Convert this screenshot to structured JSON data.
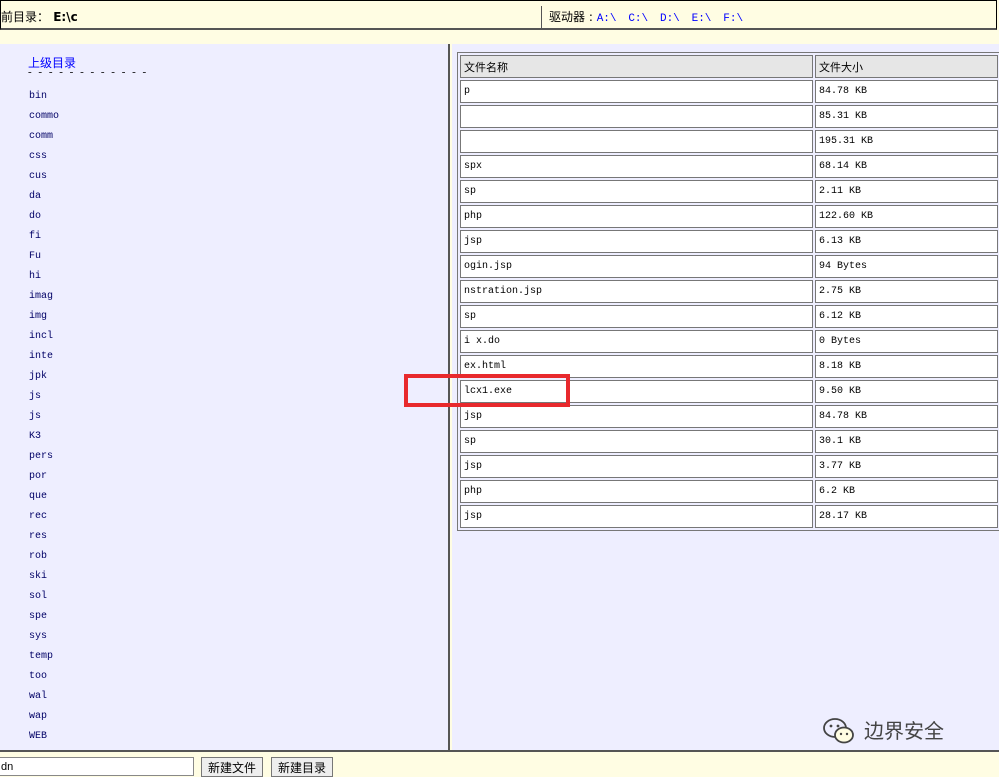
{
  "header": {
    "current_dir_label": "前目录：",
    "current_dir_value": "E:\\c",
    "drives_label": "驱动器 :",
    "drives": [
      "A:\\",
      "C:\\",
      "D:\\",
      "E:\\",
      "F:\\"
    ]
  },
  "sidebar": {
    "parent_link": "上级目录",
    "dashes": "- - - - - - - - - - - -",
    "dirs": [
      "bin",
      "commo",
      "comm",
      "css",
      "cus",
      "da",
      "do",
      "fi",
      "Fu",
      "hi",
      "imag",
      "img",
      "incl",
      "inte",
      "jpk",
      "js",
      "js",
      "K3",
      "pers",
      "por",
      "que",
      "rec",
      "res",
      "rob",
      "ski",
      "sol",
      "spe",
      "sys",
      "temp",
      "too",
      "wal",
      "wap",
      "WEB"
    ]
  },
  "file_table": {
    "headers": {
      "name": "文件名称",
      "size": "文件大小"
    },
    "rows": [
      {
        "name": "p",
        "size": "84.78 KB"
      },
      {
        "name": "",
        "size": "85.31 KB"
      },
      {
        "name": "",
        "size": "195.31 KB"
      },
      {
        "name": "spx",
        "size": "68.14 KB"
      },
      {
        "name": "sp",
        "size": "2.11 KB"
      },
      {
        "name": "php",
        "size": "122.60 KB"
      },
      {
        "name": "jsp",
        "size": "6.13 KB"
      },
      {
        "name": "ogin.jsp",
        "size": "94 Bytes"
      },
      {
        "name": "nstration.jsp",
        "size": "2.75 KB"
      },
      {
        "name": "sp",
        "size": "6.12 KB"
      },
      {
        "name": "i  x.do",
        "size": "0 Bytes"
      },
      {
        "name": "ex.html",
        "size": "8.18 KB"
      },
      {
        "name": "lcx1.exe",
        "size": "9.50 KB"
      },
      {
        "name": "jsp",
        "size": "84.78 KB"
      },
      {
        "name": "sp",
        "size": "30.1 KB"
      },
      {
        "name": "jsp",
        "size": "3.77 KB"
      },
      {
        "name": "php",
        "size": "6.2 KB"
      },
      {
        "name": "jsp",
        "size": "28.17 KB"
      }
    ]
  },
  "footer": {
    "input_value": "dn",
    "new_file_button": "新建文件",
    "new_dir_button": "新建目录"
  },
  "watermark": {
    "text": "边界安全"
  },
  "colors": {
    "highlight": "#e8292d",
    "link": "#0000ff",
    "panel_bg": "#eeeeff",
    "bar_bg": "#fffde3"
  }
}
